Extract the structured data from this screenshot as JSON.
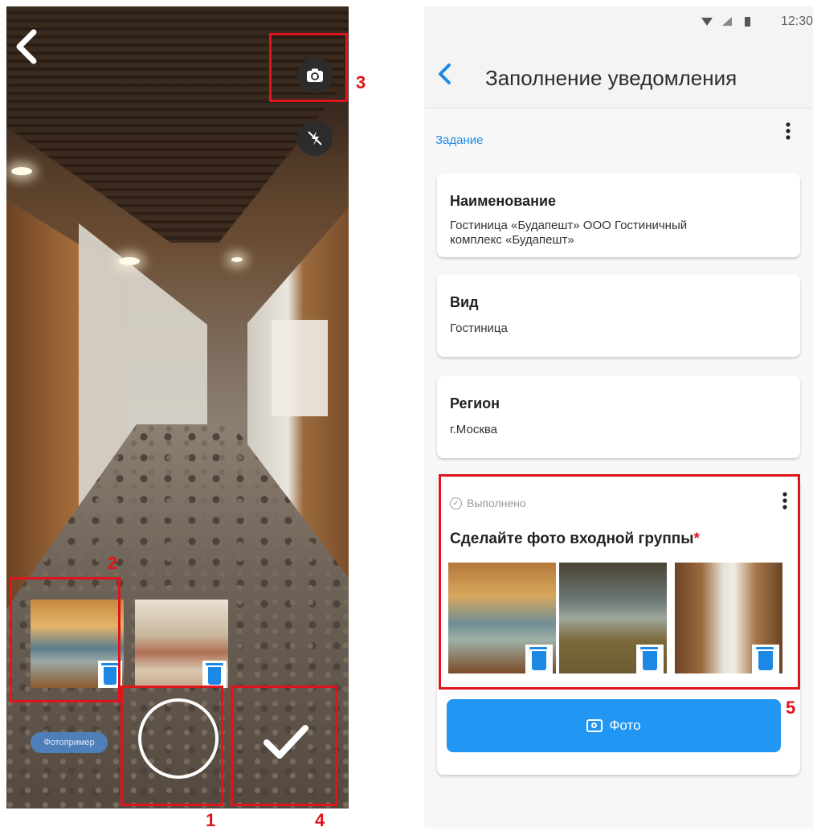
{
  "camera_screen": {
    "back_icon": "chevron-left-icon",
    "switch_camera_icon": "switch-camera-icon",
    "flash_icon": "flash-off-icon",
    "example_chip_label": "Фотопример",
    "shutter_icon": "shutter-circle-icon",
    "confirm_icon": "checkmark-icon"
  },
  "annotations": {
    "labels": [
      "1",
      "2",
      "3",
      "4",
      "5"
    ],
    "color": "#e0141c"
  },
  "form_screen": {
    "status_time": "12:30",
    "title": "Заполнение уведомления",
    "section_label": "Задание",
    "cards": [
      {
        "title": "Наименование",
        "value_line1": "Гостиница «Будапешт» ООО Гостиничный",
        "value_line2": "комплекс «Будапешт»"
      },
      {
        "title": "Вид",
        "value_line1": "Гостиница"
      },
      {
        "title": "Регион",
        "value_line1": "г.Москва"
      }
    ],
    "task": {
      "status": "Выполнено",
      "title": "Сделайте фото входной группы",
      "required_mark": "*",
      "photo_button_label": "Фото"
    },
    "accent_color": "#1e88e5"
  }
}
